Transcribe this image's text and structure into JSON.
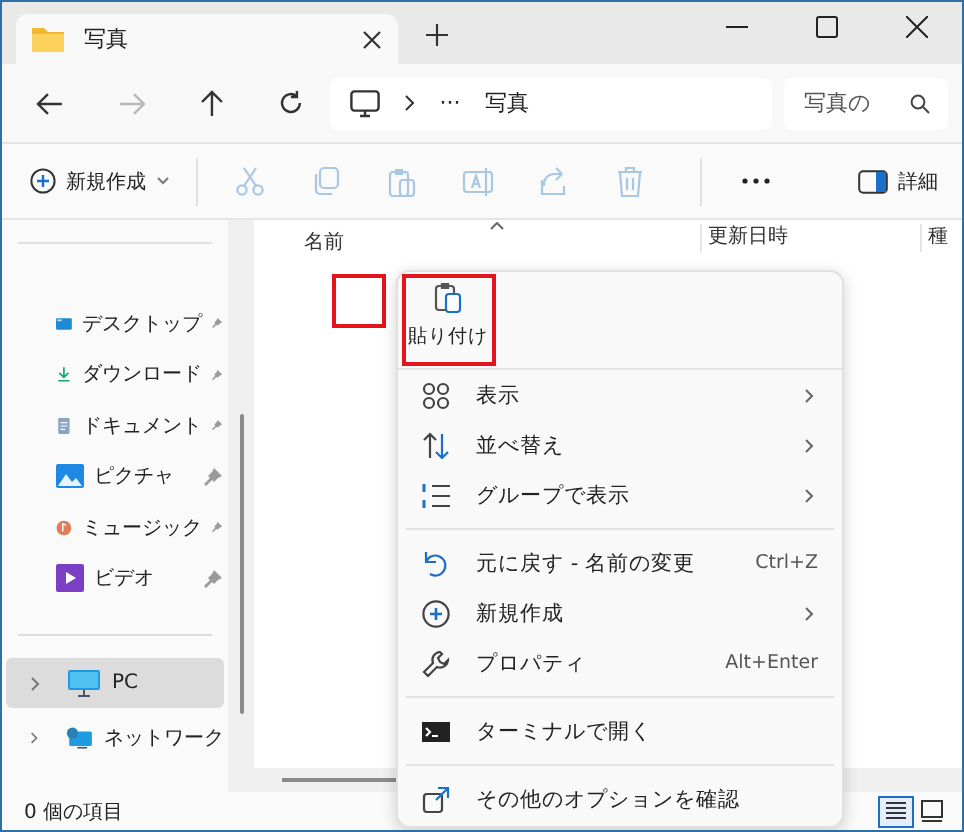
{
  "window": {
    "tab_title": "写真"
  },
  "nav": {
    "forward_disabled": true,
    "breadcrumb_overflow": "···",
    "location": "写真",
    "search_placeholder": "写真の"
  },
  "toolbar": {
    "new_label": "新規作成",
    "tools": [
      {
        "disabled": true
      },
      {
        "disabled": true
      },
      {
        "disabled": true
      },
      {
        "disabled": true
      },
      {
        "disabled": true
      },
      {
        "disabled": true
      }
    ],
    "details_label": "詳細"
  },
  "columns": [
    "名前",
    "更新日時",
    "種"
  ],
  "sidebar": {
    "quick_access": [
      {
        "label": "デスクトップ",
        "pinned": true
      },
      {
        "label": "ダウンロード",
        "pinned": true
      },
      {
        "label": "ドキュメント",
        "pinned": true
      },
      {
        "label": "ピクチャ",
        "pinned": true
      },
      {
        "label": "ミュージック",
        "pinned": true
      },
      {
        "label": "ビデオ",
        "pinned": true
      }
    ],
    "locations": [
      {
        "label": "PC",
        "selected": true,
        "expandable": true
      },
      {
        "label": "ネットワーク",
        "selected": false,
        "expandable": true
      }
    ]
  },
  "context_menu": {
    "paste_label": "貼り付け",
    "sections": [
      [
        {
          "label": "表示",
          "submenu": true
        },
        {
          "label": "並べ替え",
          "submenu": true
        },
        {
          "label": "グループで表示",
          "submenu": true
        }
      ],
      [
        {
          "label": "元に戻す - 名前の変更",
          "shortcut": "Ctrl+Z",
          "submenu": false
        },
        {
          "label": "新規作成",
          "submenu": true
        },
        {
          "label": "プロパティ",
          "shortcut": "Alt+Enter",
          "submenu": false
        }
      ],
      [
        {
          "label": "ターミナルで開く",
          "submenu": false
        }
      ],
      [
        {
          "label": "その他のオプションを確認",
          "submenu": false
        }
      ]
    ]
  },
  "status_bar": {
    "item_count": "0 個の項目",
    "views": [
      {
        "selected": true
      },
      {
        "selected": false
      }
    ]
  }
}
